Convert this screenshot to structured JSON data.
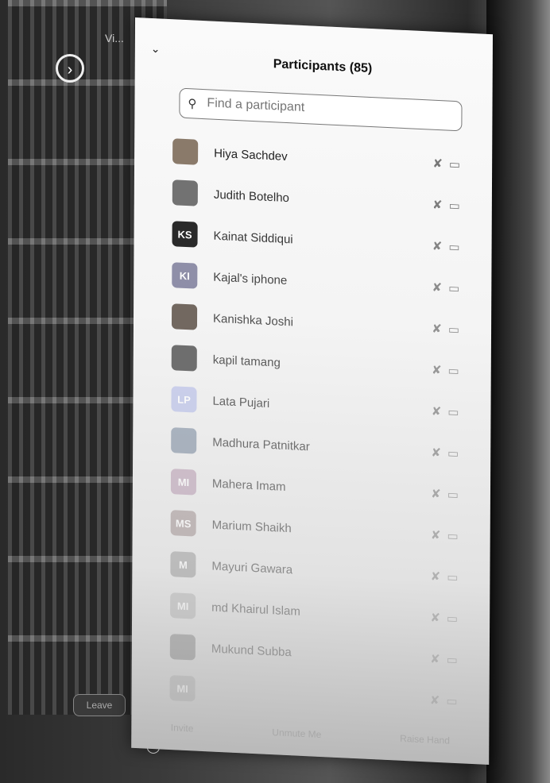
{
  "background": {
    "window_title": "Vi..."
  },
  "panel": {
    "title": "Participants (85)",
    "search_placeholder": "Find a participant"
  },
  "participants": [
    {
      "name": "Hiya Sachdev",
      "initials": "",
      "avatar_color": "#8a7a6a",
      "muted": true,
      "video_off": true
    },
    {
      "name": "Judith Botelho",
      "initials": "",
      "avatar_color": "#6a6a6a",
      "muted": true,
      "video_off": true
    },
    {
      "name": "Kainat Siddiqui",
      "initials": "KS",
      "avatar_color": "#111111",
      "muted": true,
      "video_off": true
    },
    {
      "name": "Kajal's iphone",
      "initials": "KI",
      "avatar_color": "#7b7b9a",
      "muted": true,
      "video_off": true
    },
    {
      "name": "Kanishka Joshi",
      "initials": "",
      "avatar_color": "#4d4036",
      "muted": true,
      "video_off": true
    },
    {
      "name": "kapil tamang",
      "initials": "",
      "avatar_color": "#3c3c3c",
      "muted": true,
      "video_off": true
    },
    {
      "name": "Lata Pujari",
      "initials": "LP",
      "avatar_color": "#b8bfe8",
      "muted": true,
      "video_off": true
    },
    {
      "name": "Madhura Patnitkar",
      "initials": "",
      "avatar_color": "#7f8da0",
      "muted": true,
      "video_off": true
    },
    {
      "name": "Mahera Imam",
      "initials": "MI",
      "avatar_color": "#b69ab0",
      "muted": true,
      "video_off": true
    },
    {
      "name": "Marium Shaikh",
      "initials": "MS",
      "avatar_color": "#9a8a8a",
      "muted": true,
      "video_off": true
    },
    {
      "name": "Mayuri Gawara",
      "initials": "M",
      "avatar_color": "#8d8d8d",
      "muted": true,
      "video_off": true
    },
    {
      "name": "md Khairul Islam",
      "initials": "MI",
      "avatar_color": "#a7a7a7",
      "muted": true,
      "video_off": true
    },
    {
      "name": "Mukund Subba",
      "initials": "",
      "avatar_color": "#6a6a6a",
      "muted": true,
      "video_off": true
    },
    {
      "name": "",
      "initials": "MI",
      "avatar_color": "#9b9b9b",
      "muted": true,
      "video_off": true
    }
  ],
  "footer": {
    "invite": "Invite",
    "unmute_me": "Unmute Me",
    "raise_hand": "Raise Hand"
  },
  "leave_label": "Leave",
  "icons": {
    "expand": "chevron-right-circle-icon",
    "collapse": "chevron-down-icon",
    "search": "search-icon",
    "mic_muted": "mic-muted-icon",
    "video_off": "video-off-icon"
  }
}
